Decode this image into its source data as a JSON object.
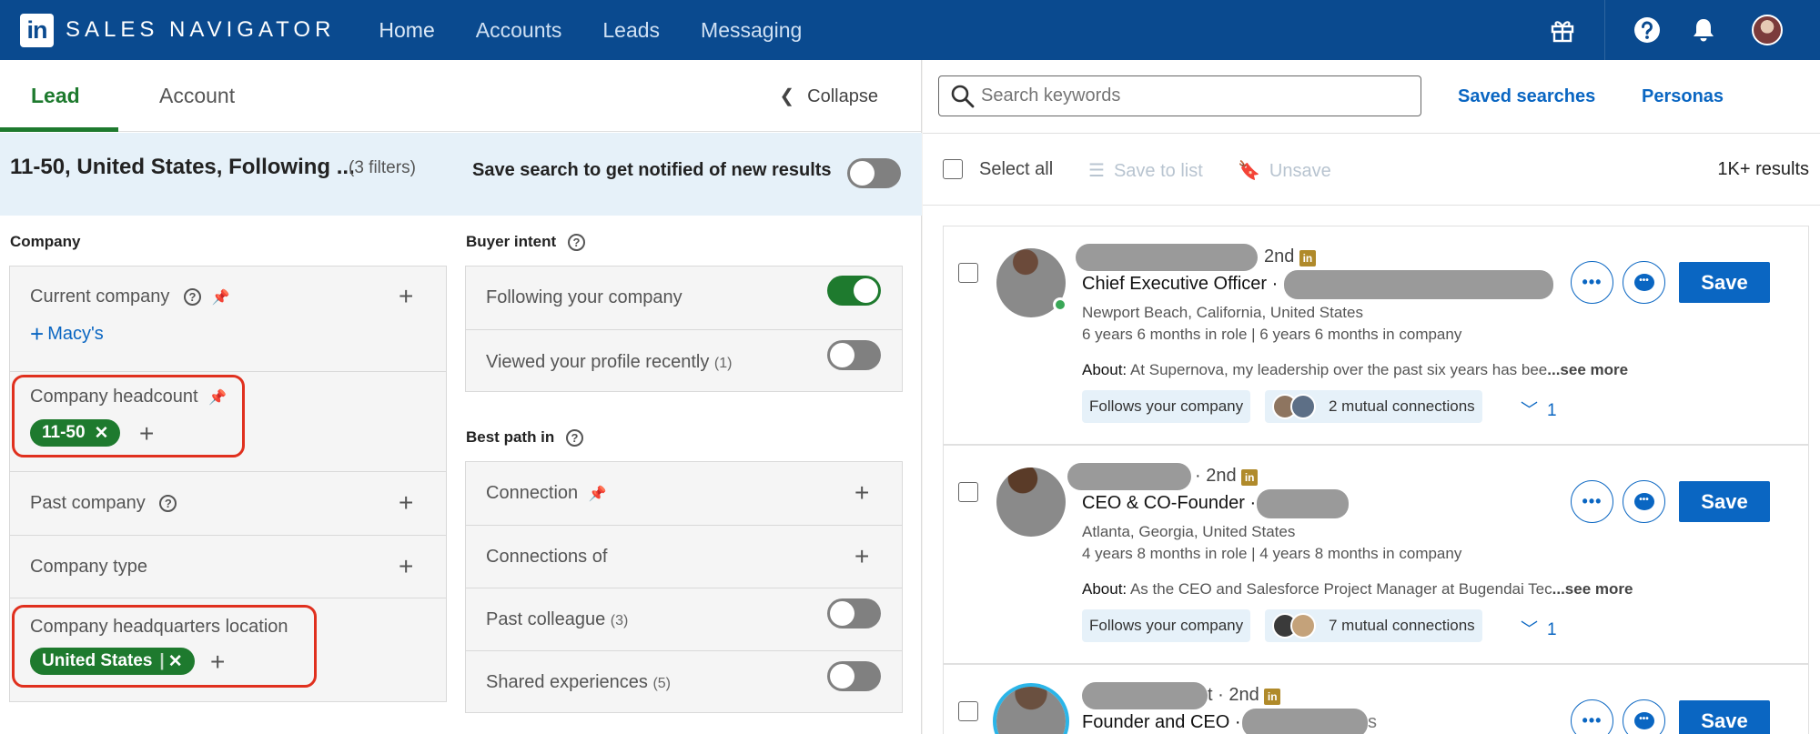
{
  "header": {
    "brand": "SALES NAVIGATOR",
    "logo": "in",
    "nav": [
      "Home",
      "Accounts",
      "Leads",
      "Messaging"
    ],
    "icons": [
      "gift-icon",
      "help-icon",
      "bell-icon",
      "avatar"
    ],
    "bg_color": "#0a4a8f"
  },
  "filters": {
    "tabs": [
      "Lead",
      "Account"
    ],
    "collapse": "Collapse",
    "banner": {
      "title": "11-50, United States, Following ...",
      "count": "(3 filters)",
      "save_text": "Save search to get notified of new results"
    },
    "company": {
      "heading": "Company",
      "current_company": "Current company",
      "current_value": "Macy's",
      "headcount": "Company headcount",
      "headcount_value": "11-50",
      "past_company": "Past company",
      "company_type": "Company type",
      "hq_location": "Company headquarters location",
      "hq_value": "United States"
    },
    "buyer_intent": {
      "heading": "Buyer intent",
      "following": "Following your company",
      "viewed": "Viewed your profile recently",
      "viewed_count": "(1)"
    },
    "best_path": {
      "heading": "Best path in",
      "connection": "Connection",
      "connections_of": "Connections of",
      "past_colleague": "Past colleague",
      "past_colleague_count": "(3)",
      "shared": "Shared experiences",
      "shared_count": "(5)"
    },
    "accent_color": "#1e7a2e"
  },
  "results": {
    "search_placeholder": "Search keywords",
    "saved_searches": "Saved searches",
    "personas": "Personas",
    "select_all": "Select all",
    "save_to_list": "Save to list",
    "unsave": "Unsave",
    "count": "1K+ results",
    "save_label": "Save",
    "see_more": "...see more",
    "about_label": "About:",
    "leads": [
      {
        "degree": "2nd",
        "title": "Chief Executive Officer ·",
        "location": "Newport Beach, California, United States",
        "tenure": "6 years 6 months in role | 6 years 6 months in company",
        "about": "At Supernova, my leadership over the past six years has bee",
        "follows": "Follows your company",
        "mutual": "2 mutual connections",
        "more": "1"
      },
      {
        "degree": "· 2nd",
        "title": "CEO & CO-Founder ·",
        "location": "Atlanta, Georgia, United States",
        "tenure": "4 years 8 months in role | 4 years 8 months in company",
        "about": "As the CEO and Salesforce Project Manager at Bugendai Tec",
        "follows": "Follows your company",
        "mutual": "7 mutual connections",
        "more": "1"
      },
      {
        "degree": "t · 2nd",
        "title": "Founder and CEO ·",
        "tail": "s"
      }
    ]
  }
}
